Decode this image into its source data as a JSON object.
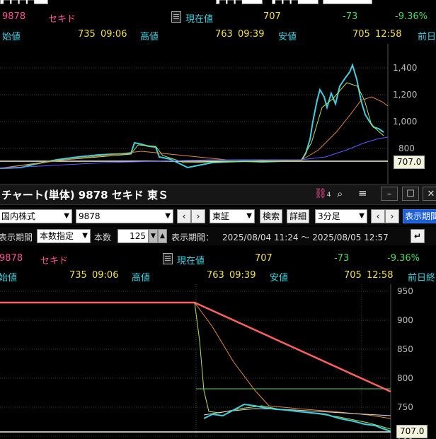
{
  "top_panel": {
    "partial_left": "■■■■",
    "partial_select_2": "■■■",
    "partial_select_3": "■■■",
    "code": "9878",
    "name": "セキド",
    "price_label": "現在値",
    "price": "707",
    "change": "-73",
    "change_pct": "-9.36%",
    "open_label": "始値",
    "open_value": "735",
    "open_time": "09:06",
    "high_label": "高値",
    "high_value": "763",
    "high_time": "09:39",
    "low_label": "安値",
    "low_value": "705",
    "low_time": "12:58",
    "prev_label": "前日",
    "y_ticks": [
      "1,400",
      "1,200",
      "1,000",
      "800"
    ],
    "price_tag": "707.0"
  },
  "window": {
    "title": "チャート(単体) 9878 セキド 東Ｓ",
    "badge": "4"
  },
  "toolbar1": {
    "market": "国内株式",
    "code": "9878",
    "exchange": "東証",
    "search": "検索",
    "detail": "詳細",
    "interval": "3分足",
    "display_settings": "表示期間"
  },
  "toolbar2": {
    "period_label": "表示期間",
    "mode": "本数指定",
    "count_label": "本数",
    "count": "125",
    "range_label": "表示期間：",
    "range": "2025/08/04 11:24 ～ 2025/08/05 12:57"
  },
  "bottom_panel": {
    "code": "9878",
    "name": "セキド",
    "price_label": "現在値",
    "price": "707",
    "change": "-73",
    "change_pct": "-9.36%",
    "open_label": "始値",
    "open_value": "735",
    "open_time": "09:06",
    "high_label": "高値",
    "high_value": "763",
    "high_time": "09:39",
    "low_label": "安値",
    "low_value": "705",
    "low_time": "12:58",
    "prev_label": "前日終",
    "y_ticks": [
      "950",
      "900",
      "850",
      "800",
      "750",
      "700"
    ],
    "price_tag": "707.0"
  },
  "colors": {
    "up_candle": "#ff4f4f",
    "down_candle": "#3fd0e0",
    "ma_short": "#b8e05a",
    "ma_mid": "#e08a3a",
    "ma_long": "#5a5aff",
    "ma_very_long": "#ff6060",
    "prev_close": "#4cd964"
  }
}
